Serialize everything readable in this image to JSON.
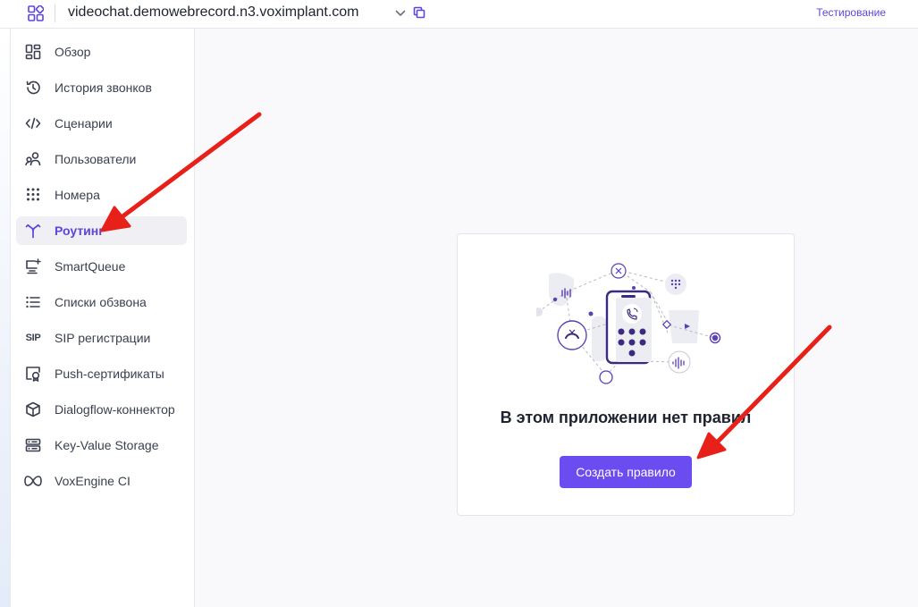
{
  "topbar": {
    "app_title": "videochat.demowebrecord.n3.voximplant.com",
    "mode_label": "Тестирование"
  },
  "sidebar": {
    "items": [
      {
        "label": "Обзор",
        "icon": "overview-icon",
        "active": false
      },
      {
        "label": "История звонков",
        "icon": "history-icon",
        "active": false
      },
      {
        "label": "Сценарии",
        "icon": "code-icon",
        "active": false
      },
      {
        "label": "Пользователи",
        "icon": "users-icon",
        "active": false
      },
      {
        "label": "Номера",
        "icon": "dialpad-icon",
        "active": false
      },
      {
        "label": "Роутинг",
        "icon": "routing-icon",
        "active": true
      },
      {
        "label": "SmartQueue",
        "icon": "smartqueue-icon",
        "active": false
      },
      {
        "label": "Списки обзвона",
        "icon": "list-icon",
        "active": false
      },
      {
        "label": "SIP регистрации",
        "icon": "sip-icon",
        "sip_glyph": "SIP",
        "active": false
      },
      {
        "label": "Push-сертификаты",
        "icon": "certificate-icon",
        "active": false
      },
      {
        "label": "Dialogflow-коннектор",
        "icon": "cube-icon",
        "active": false
      },
      {
        "label": "Key-Value Storage",
        "icon": "storage-icon",
        "active": false
      },
      {
        "label": "VoxEngine CI",
        "icon": "infinity-icon",
        "active": false
      }
    ]
  },
  "main": {
    "empty_title": "В этом приложении нет правил",
    "create_button_label": "Создать правило"
  },
  "colors": {
    "accent": "#6a4cf0",
    "active_text": "#5c46dc",
    "annotation_arrow": "#e8201a"
  }
}
